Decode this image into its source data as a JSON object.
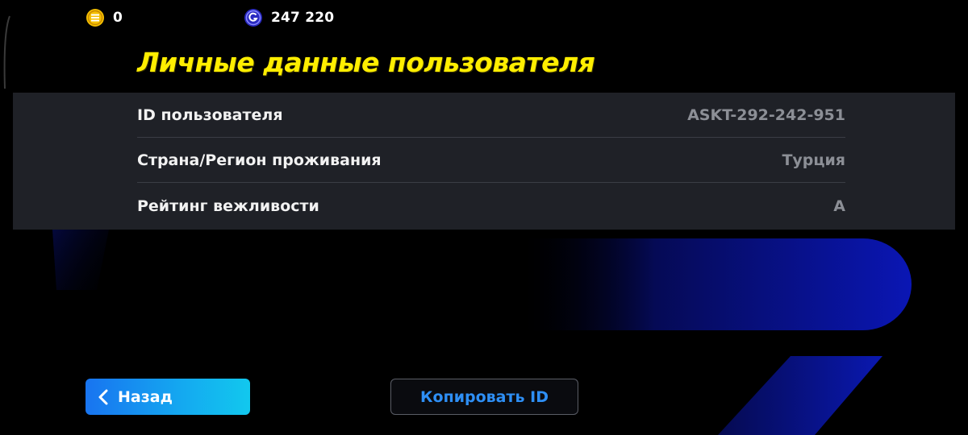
{
  "currencies": {
    "coins": {
      "icon": "coin-icon",
      "value": "0",
      "color": "#f5c000"
    },
    "gp": {
      "icon": "gp-icon",
      "value": "247 220",
      "color": "#3030d0"
    }
  },
  "page": {
    "title": "Личные данные пользователя",
    "title_color": "#ffee00"
  },
  "info": {
    "rows": [
      {
        "label": "ID пользователя",
        "value": "ASKT-292-242-951"
      },
      {
        "label": "Страна/Регион проживания",
        "value": "Турция"
      },
      {
        "label": "Рейтинг вежливости",
        "value": "A"
      }
    ]
  },
  "buttons": {
    "back": {
      "label": "Назад",
      "icon": "chevron-left-icon"
    },
    "copy_id": {
      "label": "Копировать ID",
      "color": "#2e8ff5"
    }
  },
  "theme": {
    "background": "#000000",
    "panel": "#1f2127",
    "accent_blue": "#1874f0",
    "decor_blue": "#0a14a0"
  }
}
